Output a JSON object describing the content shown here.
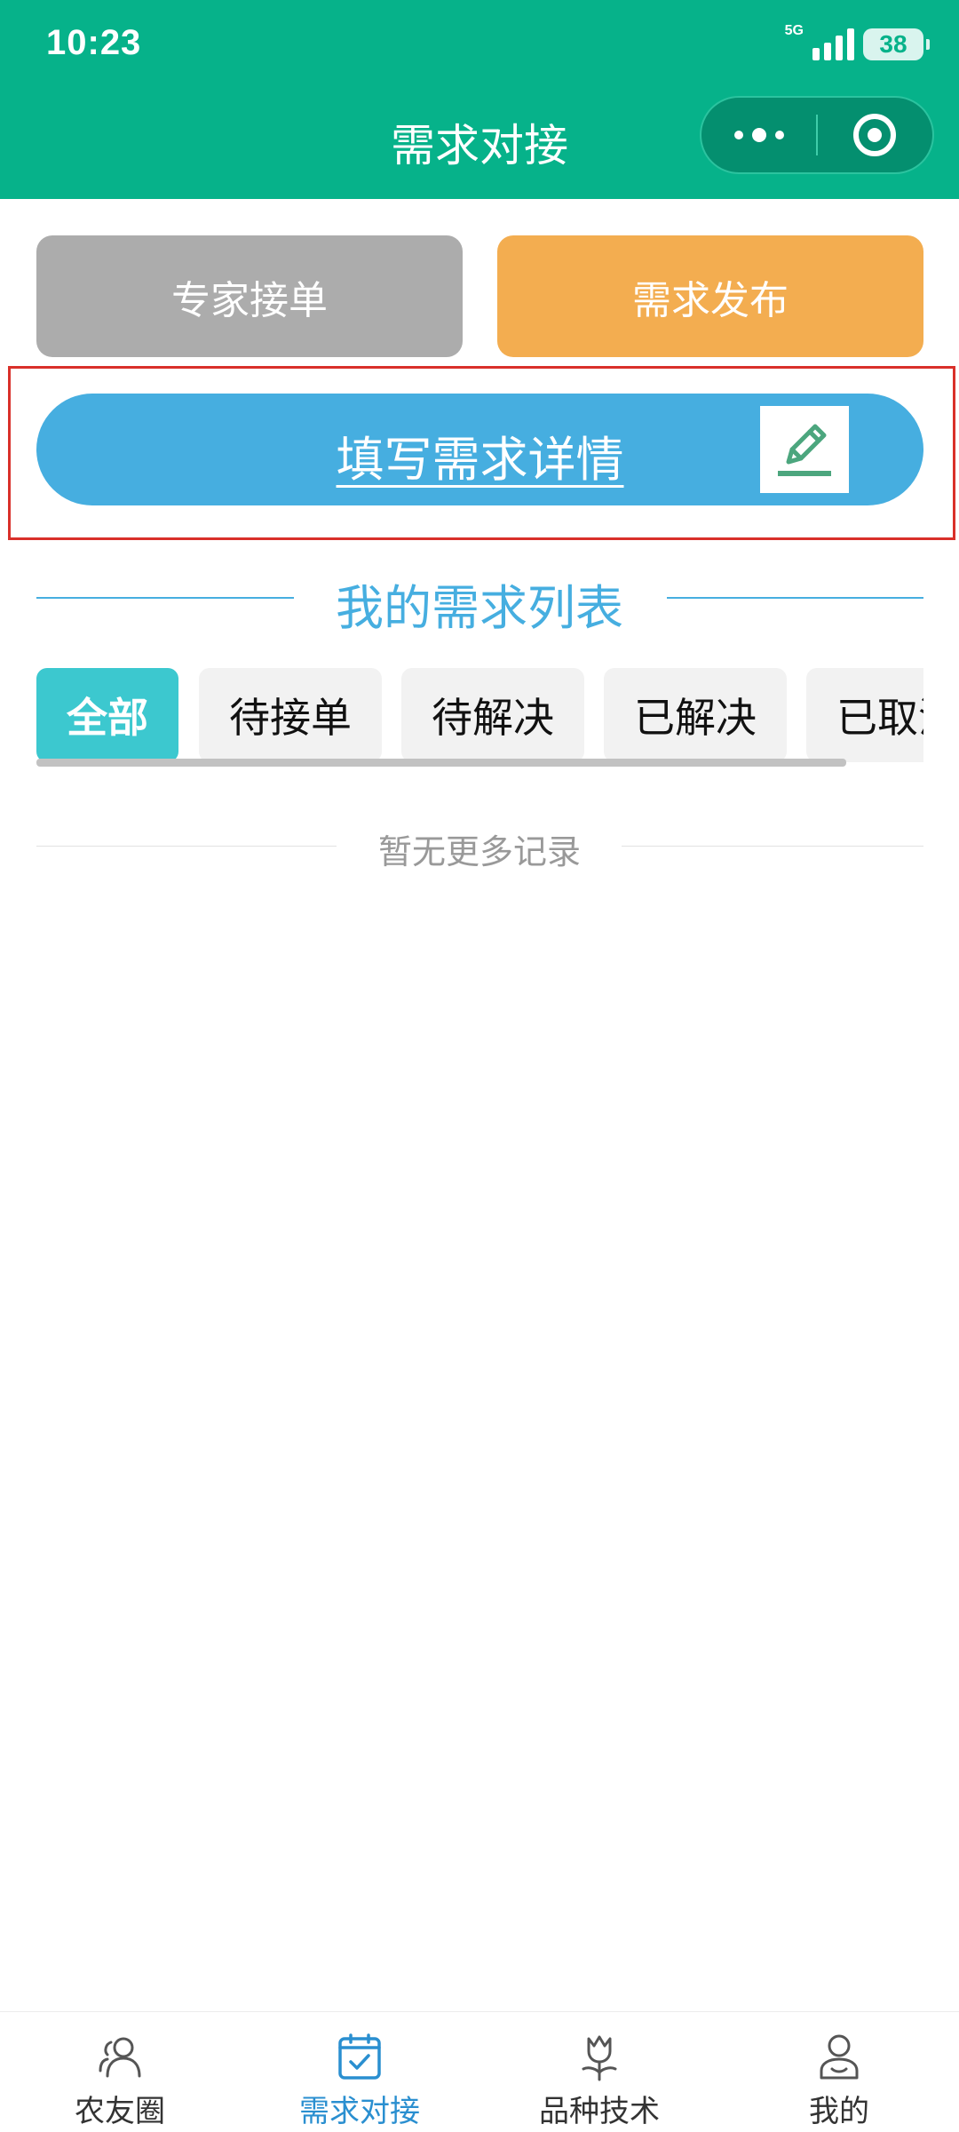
{
  "status_bar": {
    "time": "10:23",
    "network": "5G",
    "battery": "38"
  },
  "nav": {
    "title": "需求对接"
  },
  "buttons": {
    "expert_orders": "专家接单",
    "publish_demand": "需求发布",
    "fill_details": "填写需求详情"
  },
  "section": {
    "title": "我的需求列表"
  },
  "tabs": [
    {
      "label": "全部",
      "active": true
    },
    {
      "label": "待接单",
      "active": false
    },
    {
      "label": "待解决",
      "active": false
    },
    {
      "label": "已解决",
      "active": false
    },
    {
      "label": "已取消",
      "active": false
    }
  ],
  "empty_hint": "暂无更多记录",
  "tabbar": [
    {
      "label": "农友圈",
      "icon": "friends-icon",
      "active": false
    },
    {
      "label": "需求对接",
      "icon": "calendar-check-icon",
      "active": true
    },
    {
      "label": "品种技术",
      "icon": "tulip-icon",
      "active": false
    },
    {
      "label": "我的",
      "icon": "user-icon",
      "active": false
    }
  ],
  "colors": {
    "brand_green": "#06b28a",
    "expert_gray": "#acacac",
    "publish_orange": "#f3ad50",
    "fill_blue": "#46aee0",
    "tab_active_cyan": "#3cc8cf",
    "tabbar_active_blue": "#2a8fd0",
    "highlight_red": "#d9302a"
  }
}
